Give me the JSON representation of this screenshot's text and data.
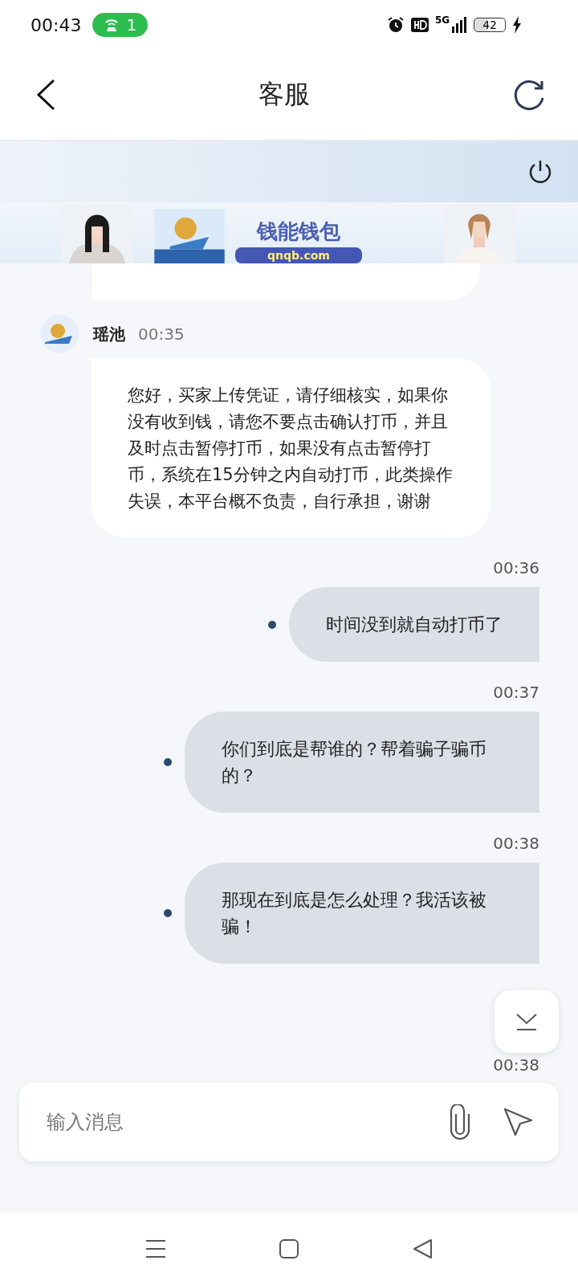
{
  "status_bar": {
    "time": "00:43",
    "hotspot_count": "1",
    "network": "5G",
    "battery": "42"
  },
  "header": {
    "title": "客服"
  },
  "banner": {
    "brand": "钱能钱包",
    "url": "qnqb.com"
  },
  "messages": [
    {
      "kind": "agent_cut"
    },
    {
      "kind": "agent",
      "sender": "瑶池",
      "time": "00:35",
      "text": "您好，买家上传凭证，请仔细核实，如果你没有收到钱，请您不要点击确认打币，并且及时点击暂停打币，如果没有点击暂停打币，系统在15分钟之内自动打币，此类操作失误，本平台概不负责，自行承担，谢谢"
    },
    {
      "kind": "user",
      "time": "00:36",
      "text": "时间没到就自动打币了"
    },
    {
      "kind": "user",
      "time": "00:37",
      "text": "你们到底是帮谁的？帮着骗子骗币的？"
    },
    {
      "kind": "user",
      "time": "00:38",
      "text": "那现在到底是怎么处理？我活该被骗！"
    },
    {
      "kind": "time_only",
      "time": "00:38"
    }
  ],
  "input": {
    "placeholder": "输入消息"
  }
}
